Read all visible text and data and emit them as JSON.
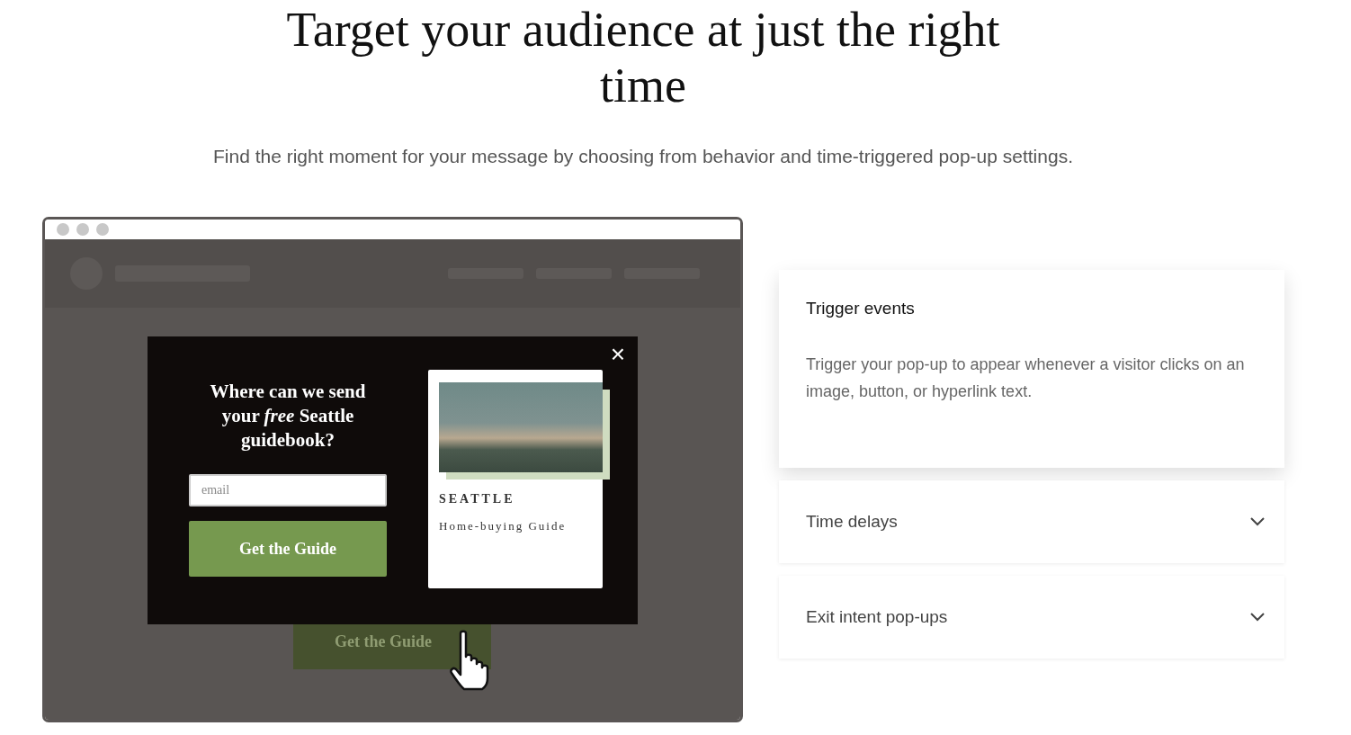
{
  "heading": "Target your audience at just the right time",
  "subtitle": "Find the right moment for your message by choosing from behavior and time-triggered pop-up settings.",
  "mockup": {
    "background_button": "Get the Guide",
    "popup": {
      "close": "×",
      "title": "Where can we send your *free* Seattle guidebook?",
      "email_placeholder": "email",
      "button": "Get the Guide",
      "guide": {
        "city": "SEATTLE",
        "subtitle": "Home-buying Guide"
      }
    }
  },
  "accordion": [
    {
      "title": "Trigger events",
      "expanded": true,
      "body": "Trigger your pop-up to appear whenever a visitor clicks on an image, button, or hyperlink text."
    },
    {
      "title": "Time delays",
      "expanded": false
    },
    {
      "title": "Exit intent pop-ups",
      "expanded": false
    }
  ]
}
